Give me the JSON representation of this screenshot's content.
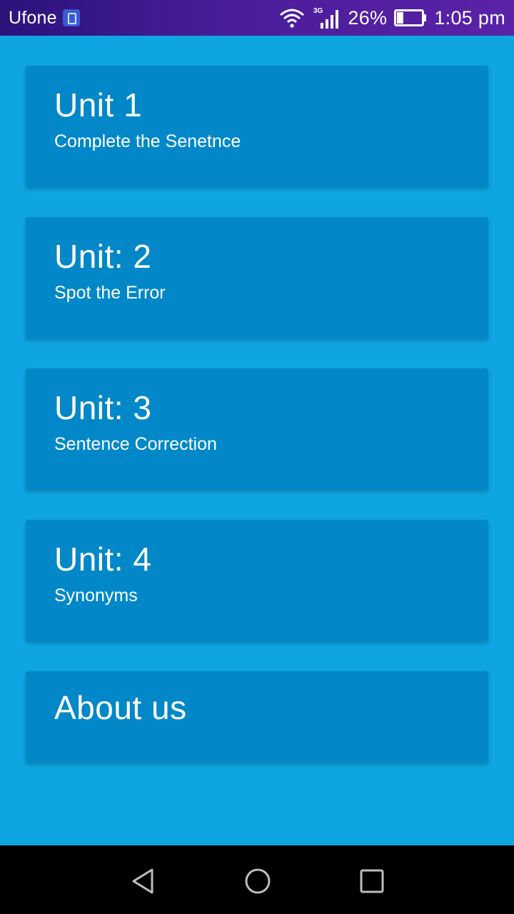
{
  "status_bar": {
    "carrier": "Ufone",
    "network_type": "3G",
    "battery_percent": "26%",
    "battery_level": 0.26,
    "time": "1:05 pm"
  },
  "cards": [
    {
      "title": "Unit 1",
      "subtitle": "Complete the Senetnce"
    },
    {
      "title": "Unit: 2",
      "subtitle": "Spot the Error"
    },
    {
      "title": "Unit: 3",
      "subtitle": "Sentence Correction"
    },
    {
      "title": "Unit: 4",
      "subtitle": "Synonyms"
    },
    {
      "title": "About us"
    }
  ],
  "nav": {
    "icons": [
      "back-icon",
      "home-icon",
      "recents-icon"
    ]
  },
  "colors": {
    "background": "#0ea5e2",
    "card": "#0288c8",
    "status_bar": "#3b1a8c",
    "nav_bar": "#000000"
  }
}
